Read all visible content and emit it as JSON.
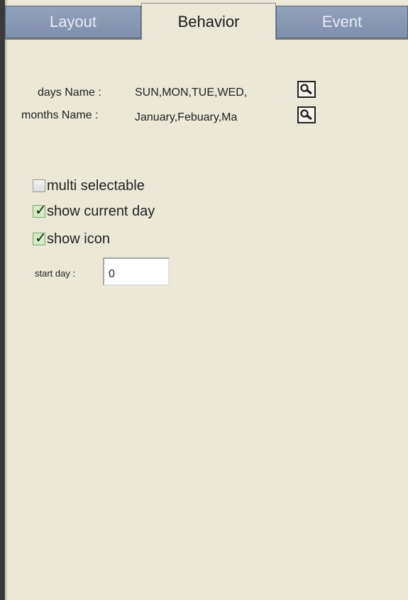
{
  "tabs": [
    {
      "label": "Layout",
      "active": false
    },
    {
      "label": "Behavior",
      "active": true
    },
    {
      "label": "Event",
      "active": false
    }
  ],
  "names": {
    "days_label": "days Name :",
    "days_value": "SUN,MON,TUE,WED,",
    "months_label": "months Name :",
    "months_value": "January,Febuary,Ma"
  },
  "options": {
    "multi_selectable": {
      "label": "multi selectable",
      "checked": false
    },
    "show_current_day": {
      "label": "show current day",
      "checked": true
    },
    "show_icon": {
      "label": "show icon",
      "checked": true
    }
  },
  "start_day": {
    "label": "start day :",
    "value": "0"
  },
  "colors": {
    "panel_bg": "#ece8d8",
    "inactive_tab": "#8a99b3",
    "checked_box": "#d4ecc4"
  },
  "icons": {
    "lookup": "magnifier-icon"
  }
}
